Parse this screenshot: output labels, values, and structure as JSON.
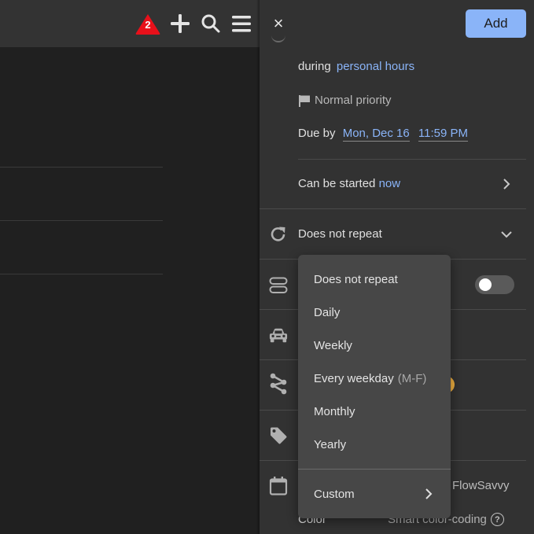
{
  "topbar": {
    "alert_count": "2",
    "add_icon": "plus-icon",
    "search_icon": "search-icon",
    "menu_icon": "hamburger-menu-icon",
    "alert_color": "#e8101a"
  },
  "panel": {
    "close_label": "×",
    "add_label": "Add",
    "during_label": "during",
    "during_value": "personal hours",
    "priority_label": "Normal priority",
    "due_label": "Due by",
    "due_date": "Mon, Dec 16",
    "due_time": "11:59 PM",
    "start_label": "Can be started",
    "start_value": "now",
    "repeat_label": "Does not repeat",
    "calendar_value": "FlowSavvy",
    "color_label": "Color",
    "color_value": "Smart color-coding",
    "help_icon": "?",
    "toggle_on": false,
    "accent_color": "#8ab4f8"
  },
  "repeat_menu": {
    "items": [
      {
        "label": "Does not repeat",
        "sub": ""
      },
      {
        "label": "Daily",
        "sub": ""
      },
      {
        "label": "Weekly",
        "sub": ""
      },
      {
        "label": "Every weekday",
        "sub": "(M-F)"
      },
      {
        "label": "Monthly",
        "sub": ""
      },
      {
        "label": "Yearly",
        "sub": ""
      }
    ],
    "custom_label": "Custom"
  }
}
